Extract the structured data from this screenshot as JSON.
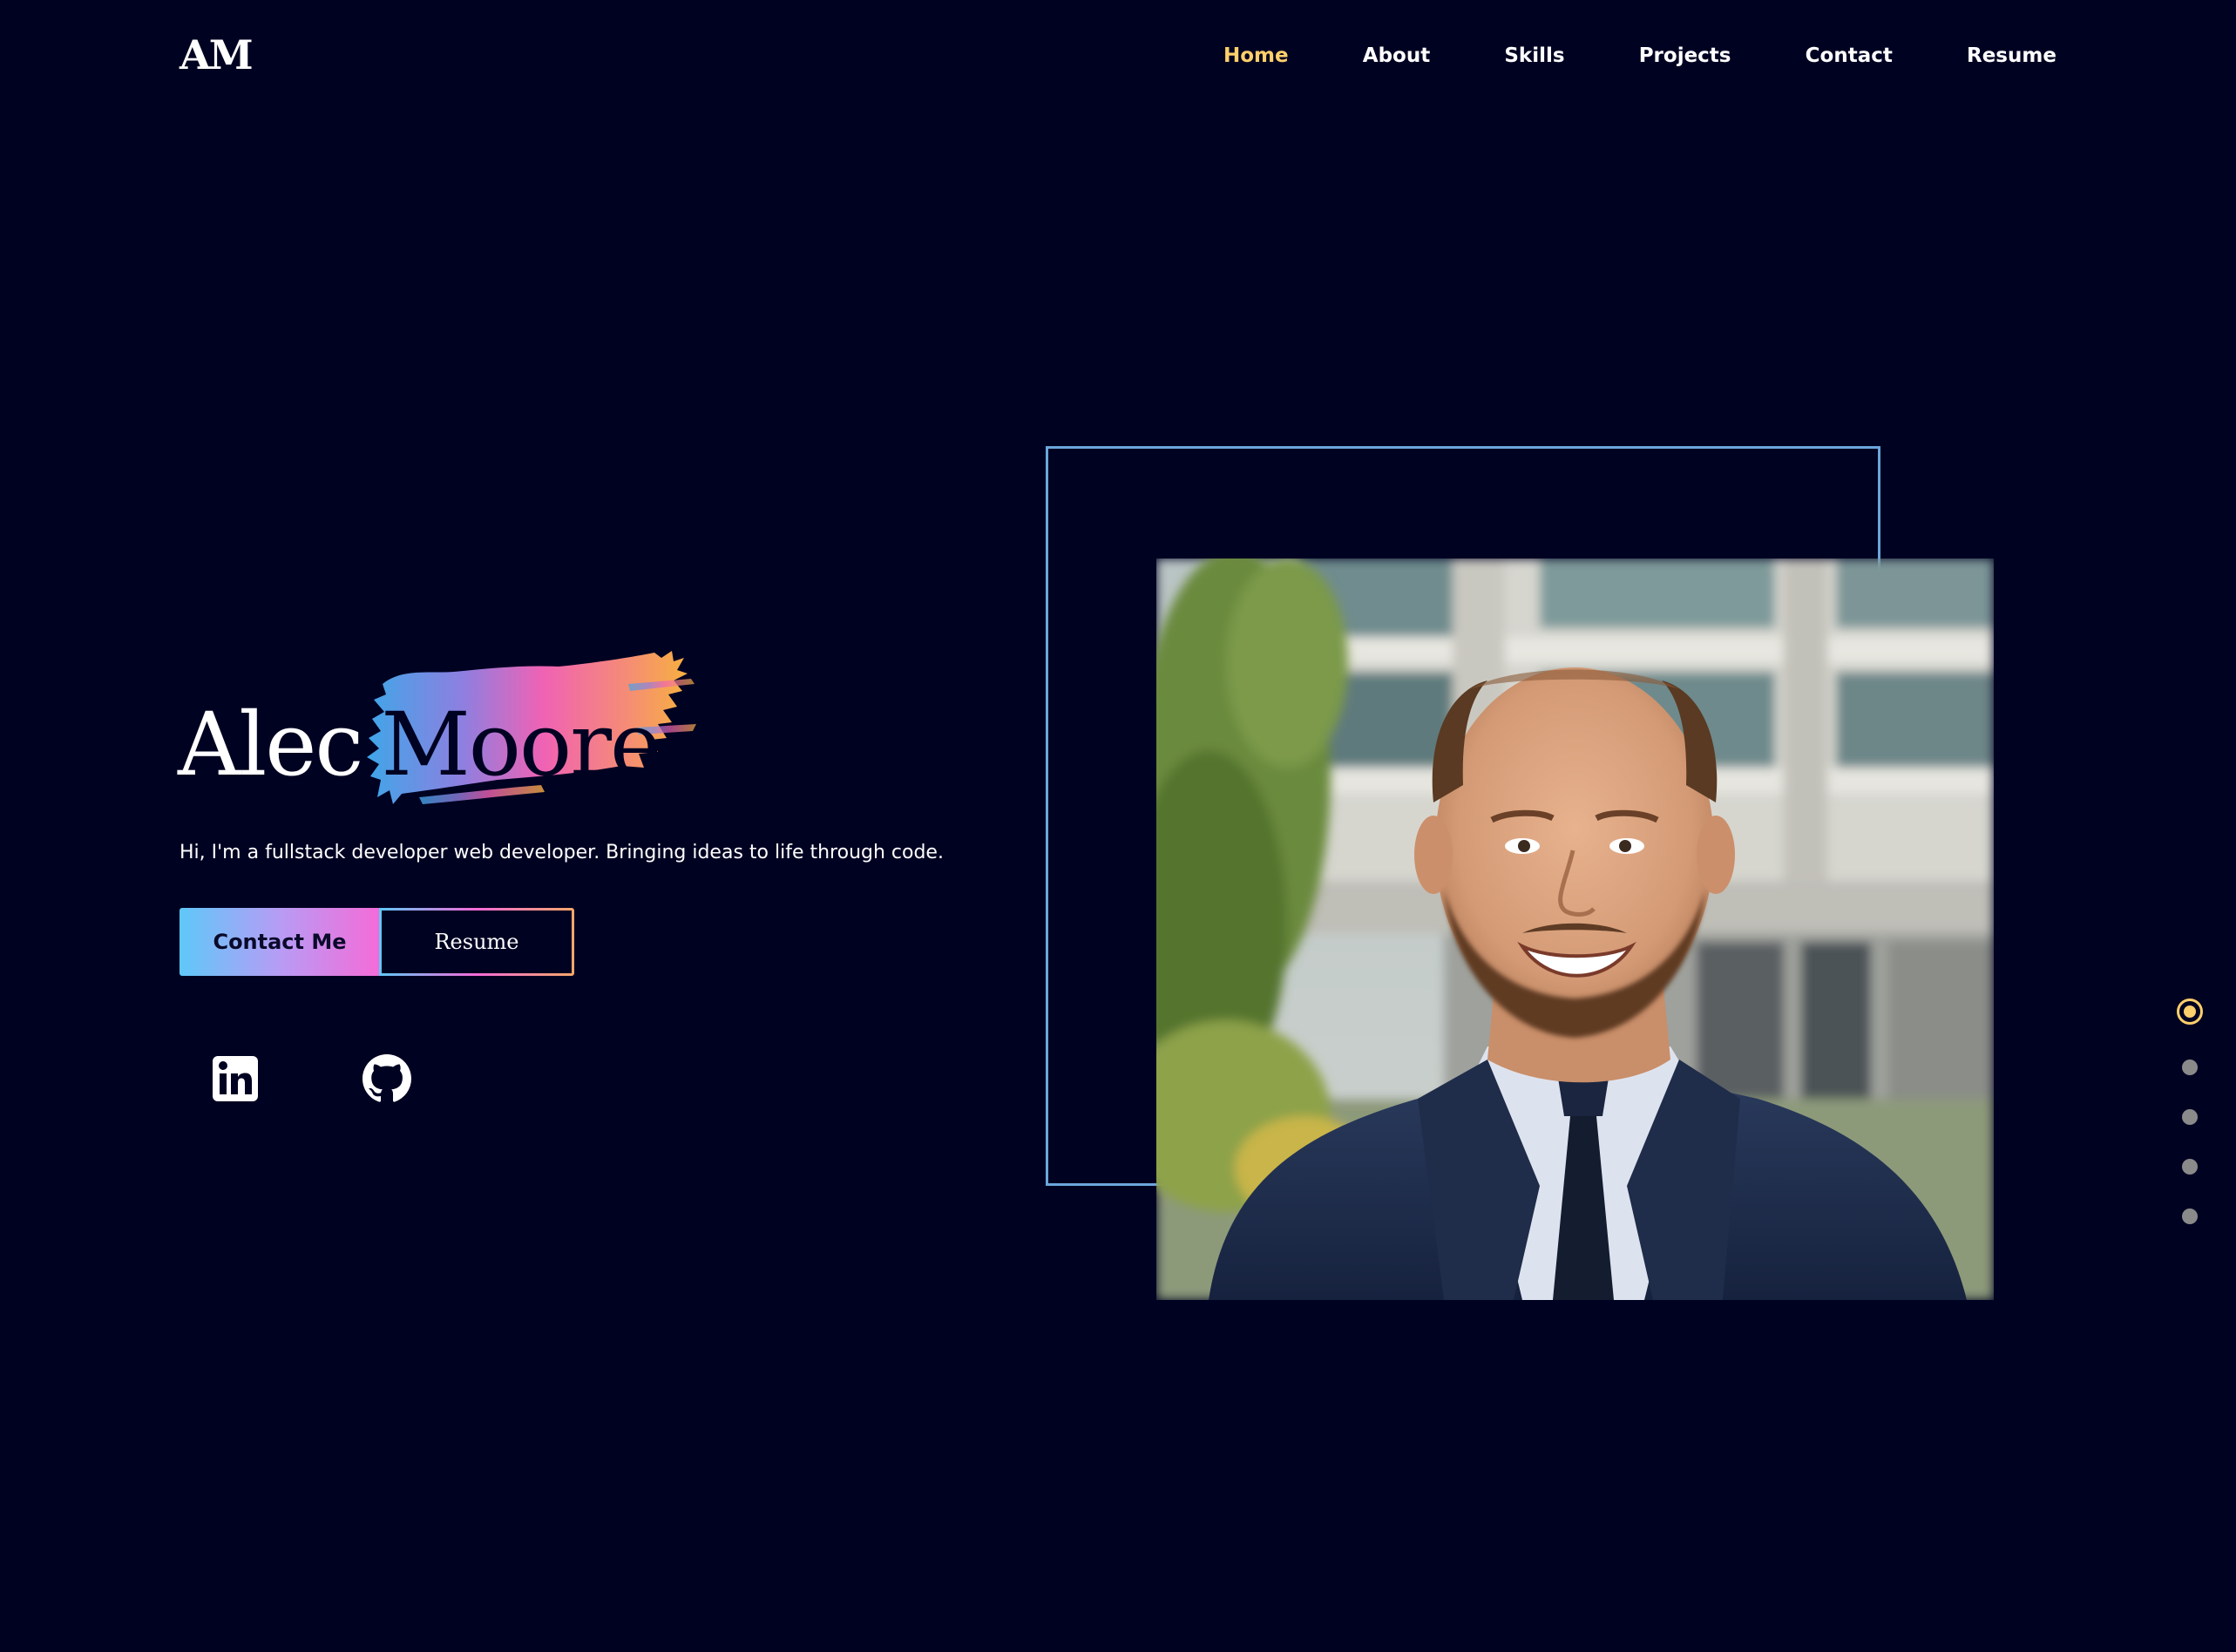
{
  "header": {
    "logo": "AM",
    "nav": [
      {
        "label": "Home",
        "active": true
      },
      {
        "label": "About",
        "active": false
      },
      {
        "label": "Skills",
        "active": false
      },
      {
        "label": "Projects",
        "active": false
      },
      {
        "label": "Contact",
        "active": false
      },
      {
        "label": "Resume",
        "active": false
      }
    ]
  },
  "hero": {
    "first_name": "Alec",
    "last_name": "Moore",
    "tagline": "Hi, I'm a fullstack developer web developer. Bringing ideas to life through code.",
    "contact_button": "Contact Me",
    "resume_button": "Resume",
    "social_icons": [
      "linkedin-icon",
      "github-icon"
    ]
  },
  "profile_photo": {
    "subject": "smiling man in navy suit and tie in front of a building"
  },
  "section_nav": {
    "count": 5,
    "active_index": 0
  },
  "colors": {
    "background": "#000222",
    "accent_active": "#ffcf6b",
    "frame_border": "#6ba6dc",
    "gradient_start": "#5ec8f8",
    "gradient_mid": "#f56bd8",
    "gradient_end": "#f7a86a"
  }
}
